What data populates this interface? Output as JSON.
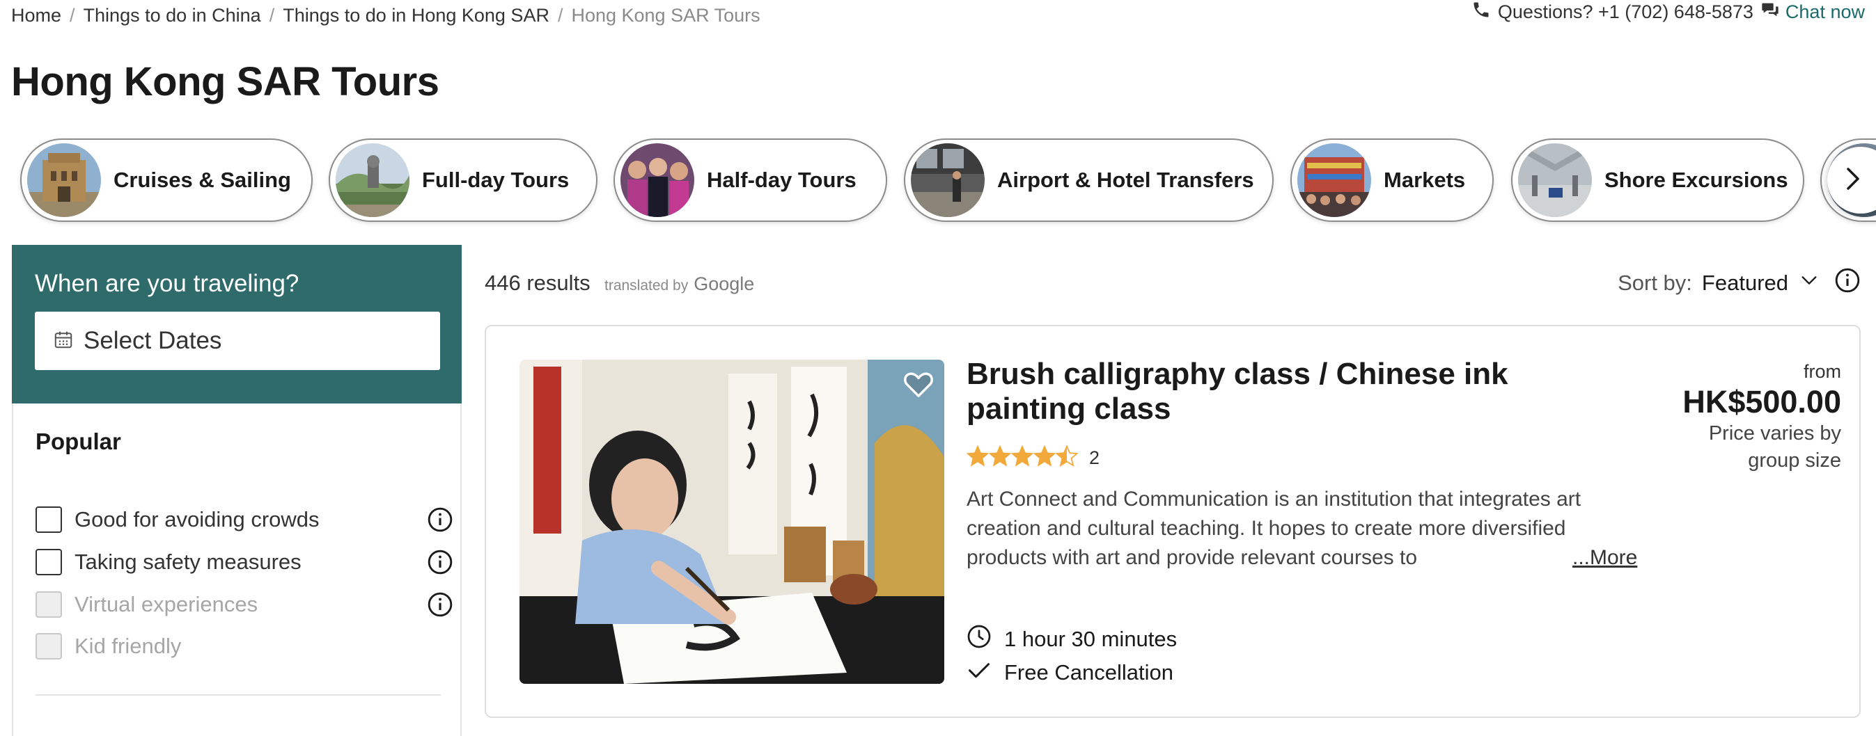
{
  "breadcrumb": [
    {
      "label": "Home"
    },
    {
      "label": "Things to do in China"
    },
    {
      "label": "Things to do in Hong Kong SAR"
    },
    {
      "label": "Hong Kong SAR Tours"
    }
  ],
  "contact": {
    "questions": "Questions? +1 (702) 648-5873",
    "chat": "Chat now"
  },
  "page_title": "Hong Kong SAR Tours",
  "categories": [
    {
      "label": "Cruises & Sailing"
    },
    {
      "label": "Full-day Tours"
    },
    {
      "label": "Half-day Tours"
    },
    {
      "label": "Airport & Hotel Transfers"
    },
    {
      "label": "Markets"
    },
    {
      "label": "Shore Excursions"
    }
  ],
  "sidebar": {
    "date_label": "When are you traveling?",
    "date_button": "Select Dates",
    "popular_title": "Popular",
    "filters": [
      {
        "label": "Good for avoiding crowds",
        "enabled": true,
        "has_info": true
      },
      {
        "label": "Taking safety measures",
        "enabled": true,
        "has_info": true
      },
      {
        "label": "Virtual experiences",
        "enabled": false,
        "has_info": true
      },
      {
        "label": "Kid friendly",
        "enabled": false,
        "has_info": false
      }
    ]
  },
  "results": {
    "count": "446 results",
    "translated_by": "translated by",
    "google": "Google",
    "sort_label": "Sort by:",
    "sort_value": "Featured"
  },
  "product": {
    "title": "Brush calligraphy class / Chinese ink painting class",
    "rating": 4.5,
    "review_count": "2",
    "description": "Art Connect and Communication is an institution that integrates art creation and cultural teaching. It hopes to create more diversified products with art and provide relevant courses to",
    "more": "...More",
    "duration": "1 hour 30 minutes",
    "cancellation": "Free Cancellation",
    "price_from": "from",
    "price": "HK$500.00",
    "price_note": "Price varies by group size"
  },
  "colors": {
    "accent_teal": "#2f6b6b",
    "star": "#f2a93b",
    "link_teal": "#1b6b6b"
  },
  "icons": {
    "phone": "phone-icon",
    "chat": "chat-bubble-icon",
    "calendar": "calendar-icon",
    "info": "info-icon",
    "heart": "heart-icon",
    "clock": "clock-icon",
    "check": "check-icon",
    "chevron_down": "chevron-down-icon",
    "chevron_right": "chevron-right-icon"
  }
}
